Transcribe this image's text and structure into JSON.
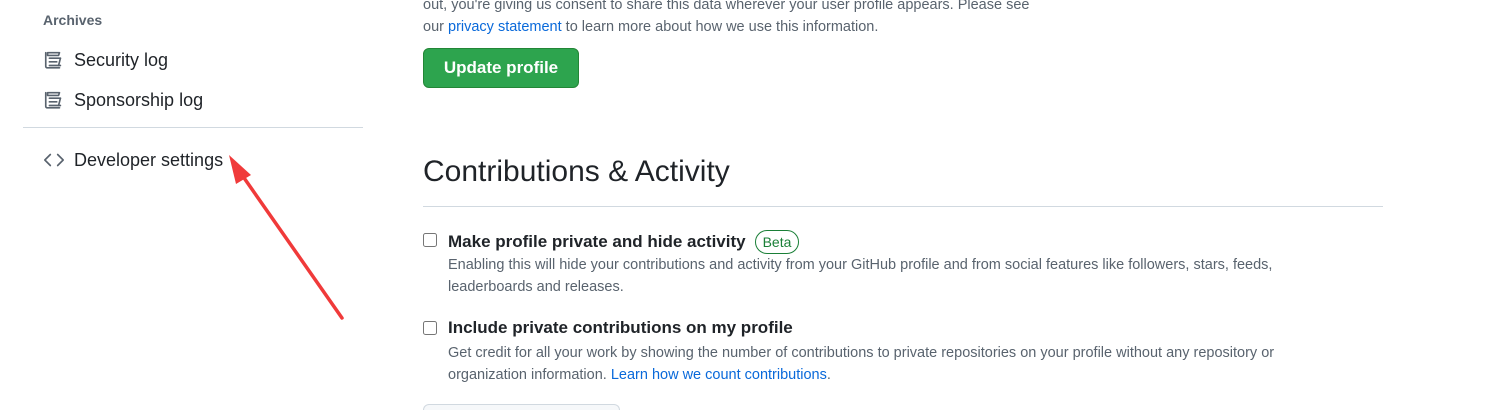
{
  "sidebar": {
    "archives_heading": "Archives",
    "items": [
      {
        "label": "Security log",
        "icon": "log-icon"
      },
      {
        "label": "Sponsorship log",
        "icon": "log-icon"
      }
    ],
    "developer_settings": {
      "label": "Developer settings",
      "icon": "code-icon"
    }
  },
  "main": {
    "consent": {
      "line1": "out, you're giving us consent to share this data wherever your user profile appears. Please see",
      "line2_prefix": "our ",
      "line2_link": "privacy statement",
      "line2_suffix": " to learn more about how we use this information."
    },
    "update_button": "Update profile",
    "section_title": "Contributions & Activity",
    "options": [
      {
        "label": "Make profile private and hide activity",
        "badge": "Beta",
        "description": "Enabling this will hide your contributions and activity from your GitHub profile and from social features like followers, stars, feeds, leaderboards and releases.",
        "checked": false
      },
      {
        "label": "Include private contributions on my profile",
        "description_prefix": "Get credit for all your work by showing the number of contributions to private repositories on your profile without any repository or organization information. ",
        "description_link": "Learn how we count contributions",
        "description_suffix": ".",
        "checked": false
      }
    ]
  },
  "colors": {
    "primary_button": "#2da44e",
    "link": "#0969da",
    "badge": "#1a7f37",
    "annotation_arrow": "#f03a3a"
  }
}
